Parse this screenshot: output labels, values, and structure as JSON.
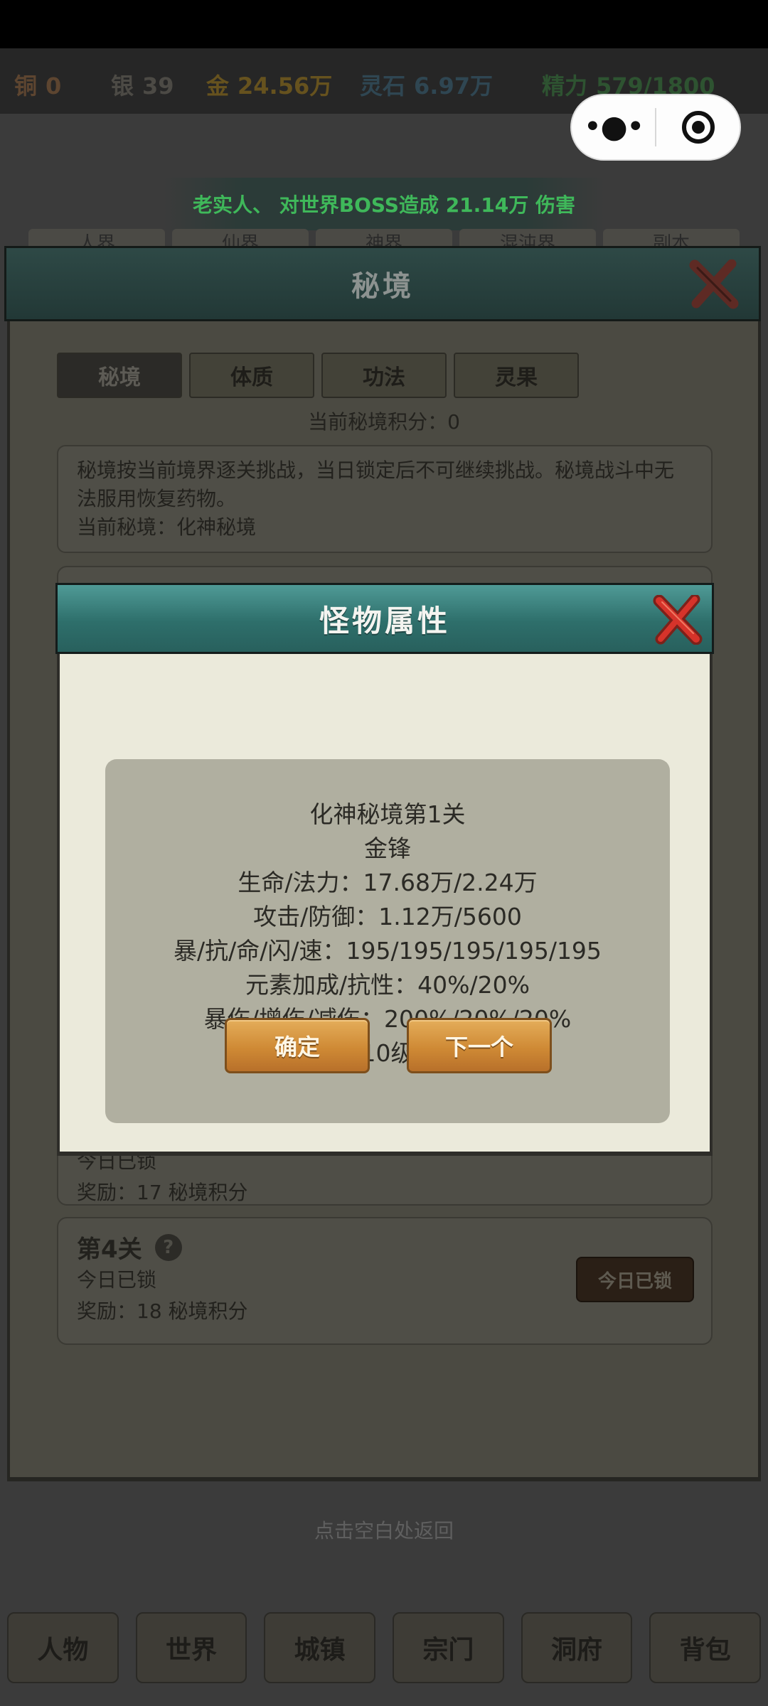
{
  "resources": {
    "copper_label": "铜",
    "copper_value": "0",
    "silver_label": "银",
    "silver_value": "39",
    "gold_label": "金",
    "gold_value": "24.56万",
    "spirit_stone_label": "灵石",
    "spirit_stone_value": "6.97万",
    "energy_label": "精力",
    "energy_value": "579/1800"
  },
  "capsule": {
    "more_icon": "more-dots-icon",
    "close_icon": "target-circle-icon"
  },
  "boss_banner": "老实人、 对世界BOSS造成 21.14万 伤害",
  "back_tabs": [
    "人界",
    "仙界",
    "神界",
    "混沌界",
    "副本"
  ],
  "secret_panel": {
    "title": "秘境",
    "tabs": [
      "秘境",
      "体质",
      "功法",
      "灵果"
    ],
    "score_line": "当前秘境积分：0",
    "info_text": "秘境按当前境界逐关挑战，当日锁定后不可继续挑战。秘境战斗中无法服用恢复药物。",
    "current_secret": "当前秘境：化神秘境",
    "level3_status": "今日已锁",
    "level3_reward": "奖励：17 秘境积分",
    "level4": {
      "title": "第4关",
      "status": "今日已锁",
      "reward": "奖励：18 秘境积分",
      "button": "今日已锁"
    }
  },
  "back_hint": "点击空白处返回",
  "bottom_nav": [
    "人物",
    "世界",
    "城镇",
    "宗门",
    "洞府",
    "背包"
  ],
  "modal": {
    "title": "怪物属性",
    "stats": [
      "化神秘境第1关",
      "金锋",
      "生命/法力：17.68万/2.24万",
      "攻击/防御：1.12万/5600",
      "暴/抗/命/闪/速：195/195/195/195/195",
      "元素加成/抗性：40%/20%",
      "暴伤/增伤/减伤：200%/20%/20%",
      "技能：10级碎金斩"
    ],
    "confirm_button": "确定",
    "next_button": "下一个"
  },
  "colors": {
    "modal_header": "#2e6f6b",
    "modal_body": "#ebeadb",
    "stat_box": "#b0afa0",
    "button_orange": "#cf8a35",
    "close_red": "#d6332a",
    "boss_green": "#3fb85a"
  }
}
